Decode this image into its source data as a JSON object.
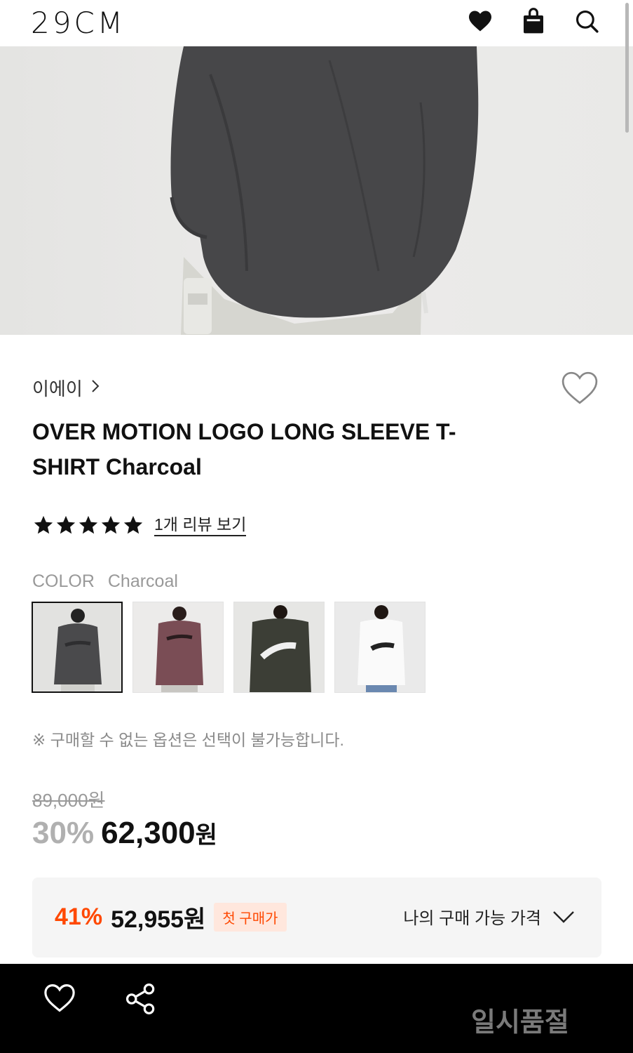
{
  "header": {
    "logo": "29CM",
    "icons": [
      "heart-icon",
      "shopping-bag-icon",
      "search-icon"
    ]
  },
  "product": {
    "brand": "이에이",
    "title": "OVER MOTION LOGO LONG SLEEVE T-SHIRT Charcoal",
    "rating_stars": 5,
    "review_link": "1개 리뷰 보기",
    "color_label": "COLOR",
    "color_value": "Charcoal",
    "swatches": [
      {
        "color": "#4a4a4a",
        "selected": true
      },
      {
        "color": "#7a4d55",
        "selected": false
      },
      {
        "color": "#3c3e36",
        "selected": false
      },
      {
        "color": "#f4f4f4",
        "selected": false
      }
    ],
    "notice": "※ 구매할 수 없는 옵션은 선택이 불가능합니다."
  },
  "price": {
    "original": "89,000원",
    "discount": "30%",
    "sale": "62,300",
    "currency": "원"
  },
  "coupon": {
    "discount": "41%",
    "price": "52,955원",
    "badge": "첫 구매가",
    "toggle_label": "나의 구매 가능 가격"
  },
  "bottom_bar": {
    "soldout_label": "일시품절"
  },
  "colors": {
    "accent": "#ff4800",
    "badge_bg": "#ffe7dd",
    "bottom_bg": "#000000"
  }
}
